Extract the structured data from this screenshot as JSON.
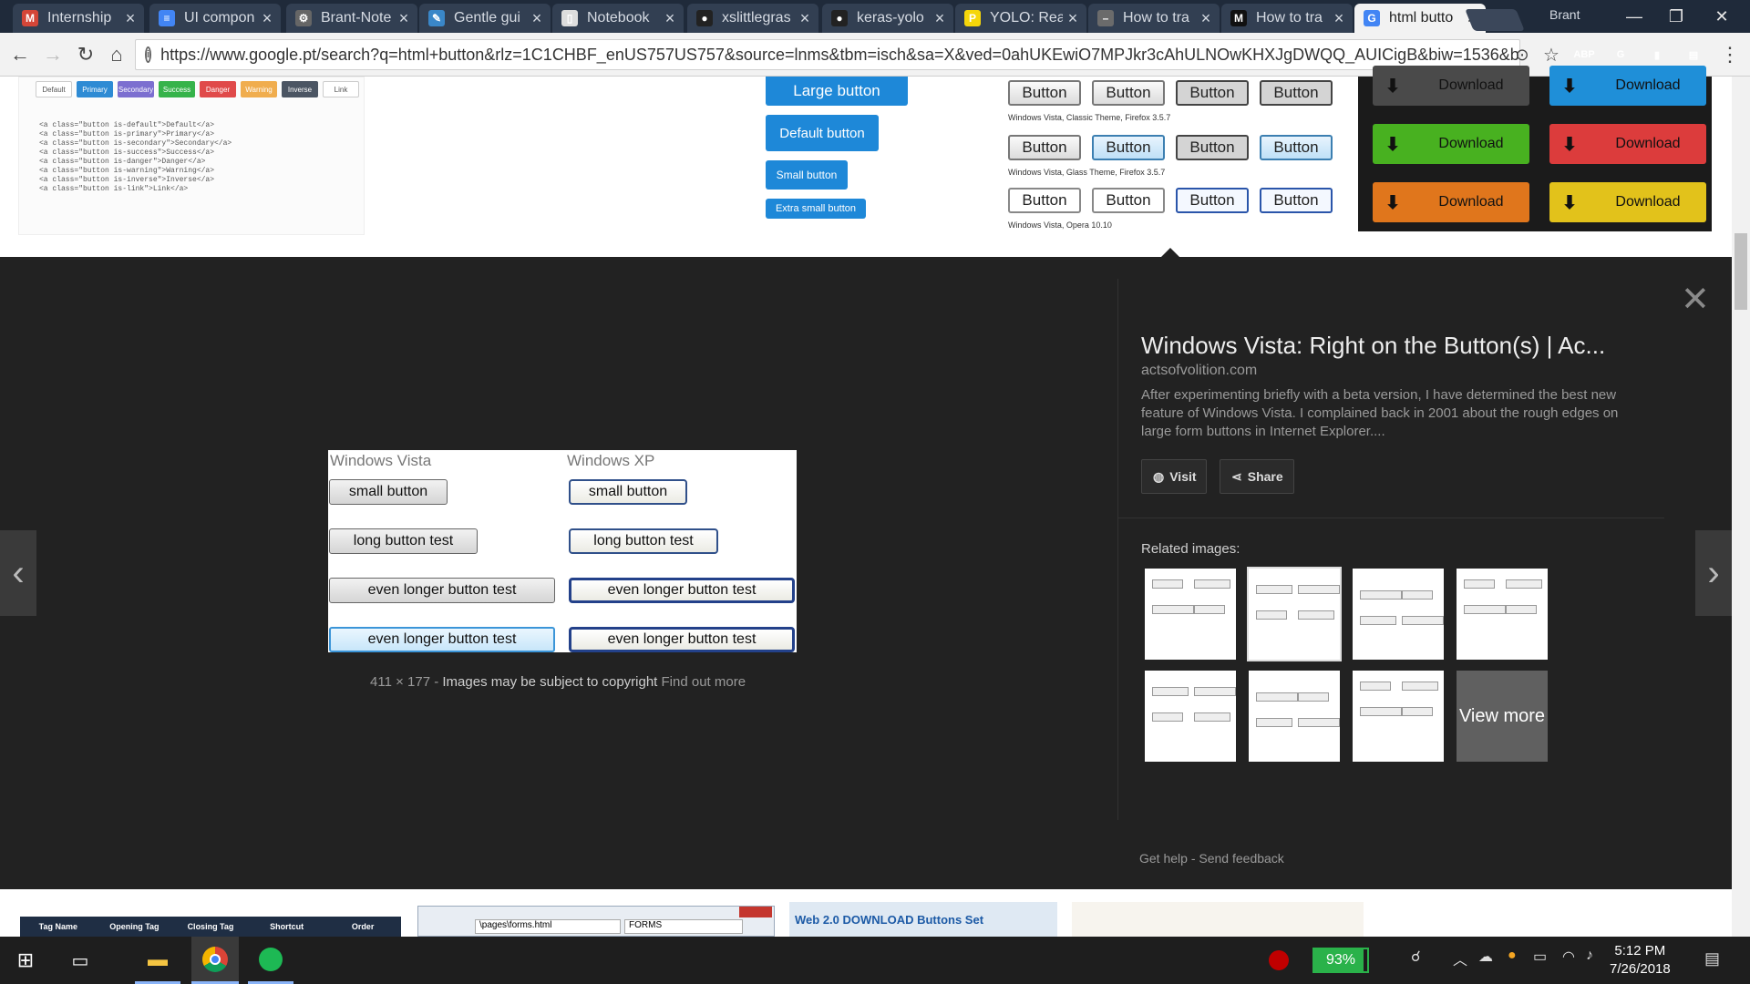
{
  "browser": {
    "tabs": [
      {
        "label": "Internship",
        "icon_color": "#d44638",
        "icon_glyph": "M",
        "active": false
      },
      {
        "label": "UI compon",
        "icon_color": "#4285f4",
        "icon_glyph": "≡",
        "active": false
      },
      {
        "label": "Brant-Note",
        "icon_color": "#666666",
        "icon_glyph": "⚙",
        "active": false
      },
      {
        "label": "Gentle gui",
        "icon_color": "#3a87c8",
        "icon_glyph": "✎",
        "active": false
      },
      {
        "label": "Notebook",
        "icon_color": "#dddddd",
        "icon_glyph": "▯",
        "active": false
      },
      {
        "label": "xslittlegras",
        "icon_color": "#222222",
        "icon_glyph": "●",
        "active": false
      },
      {
        "label": "keras-yolo",
        "icon_color": "#222222",
        "icon_glyph": "●",
        "active": false
      },
      {
        "label": "YOLO: Real",
        "icon_color": "#f5d60a",
        "icon_glyph": "P",
        "active": false
      },
      {
        "label": "How to tra",
        "icon_color": "#6b6b6b",
        "icon_glyph": "–",
        "active": false
      },
      {
        "label": "How to tra",
        "icon_color": "#111111",
        "icon_glyph": "M",
        "active": false
      },
      {
        "label": "html butto",
        "icon_color": "#4285f4",
        "icon_glyph": "G",
        "active": true
      }
    ],
    "tab_close": "×",
    "user_name": "Brant",
    "url": "https://www.google.pt/search?q=html+button&rlz=1C1CHBF_enUS757US757&source=lnms&tbm=isch&sa=X&ved=0ahUKEwiO7MPJkr3cAhULNOwKHXJgDWQQ_AUICigB&biw=1536&bi...",
    "extensions": [
      {
        "name": "abp",
        "label": "ABP",
        "color": "#c00000"
      },
      {
        "name": "grammarly",
        "label": "G",
        "color": "#15c39a"
      },
      {
        "name": "bookmark",
        "label": "▮",
        "color": "#1a73e8"
      },
      {
        "name": "notes",
        "label": "▤",
        "color": "#e8b61a"
      }
    ]
  },
  "results_top": {
    "bootstrap_labels": [
      "Default",
      "Primary",
      "Secondary",
      "Success",
      "Danger",
      "Warning",
      "Inverse",
      "Link"
    ],
    "code_lines": [
      "<a class=\"button is-default\">Default</a>",
      "<a class=\"button is-primary\">Primary</a>",
      "<a class=\"button is-secondary\">Secondary</a>",
      "<a class=\"button is-success\">Success</a>",
      "<a class=\"button is-danger\">Danger</a>",
      "<a class=\"button is-warning\">Warning</a>",
      "<a class=\"button is-inverse\">Inverse</a>",
      "<a class=\"button is-link\">Link</a>"
    ],
    "blue_buttons": [
      "Large button",
      "Default button",
      "Small button",
      "Extra small button"
    ],
    "vista_button_label": "Button",
    "vista_captions": [
      "Windows Vista, Classic Theme, Firefox 3.5.7",
      "Windows Vista, Glass Theme, Firefox 3.5.7",
      "Windows Vista, Opera 10.10"
    ],
    "download_label": "Download",
    "download_colors": [
      "#4a4a4a",
      "#1f8fd8",
      "#48b120",
      "#dc3c3c",
      "#e0761c",
      "#e2c21b"
    ]
  },
  "preview": {
    "col_left": "Windows Vista",
    "col_right": "Windows XP",
    "btn_small": "small button",
    "btn_long": "long button test",
    "btn_longer": "even longer button test",
    "size": "411 × 177",
    "copyright": "Images may be subject to copyright",
    "find_out_more": "Find out more"
  },
  "panel": {
    "title": "Windows Vista: Right on the Button(s) | Ac...",
    "domain": "actsofvolition.com",
    "description": "After experimenting briefly with a beta version, I have determined the best new feature of Windows Vista. I complained back in 2001 about the rough edges on large form buttons in Internet Explorer....",
    "visit_label": "Visit",
    "share_label": "Share",
    "related_label": "Related images:",
    "view_more": "View more",
    "get_help": "Get help",
    "send_feedback": "Send feedback",
    "sep": "-"
  },
  "bottom_strip": {
    "table_headers": [
      "Tag Name",
      "Opening Tag",
      "Closing Tag",
      "Shortcut",
      "Order"
    ],
    "forms_path": "\\pages\\forms.html",
    "forms_tab": "FORMS",
    "web20_label": "Web 2.0 DOWNLOAD Buttons Set"
  },
  "taskbar": {
    "battery_percent": 93,
    "battery_text": "93%",
    "time": "5:12 PM",
    "date": "7/26/2018"
  }
}
